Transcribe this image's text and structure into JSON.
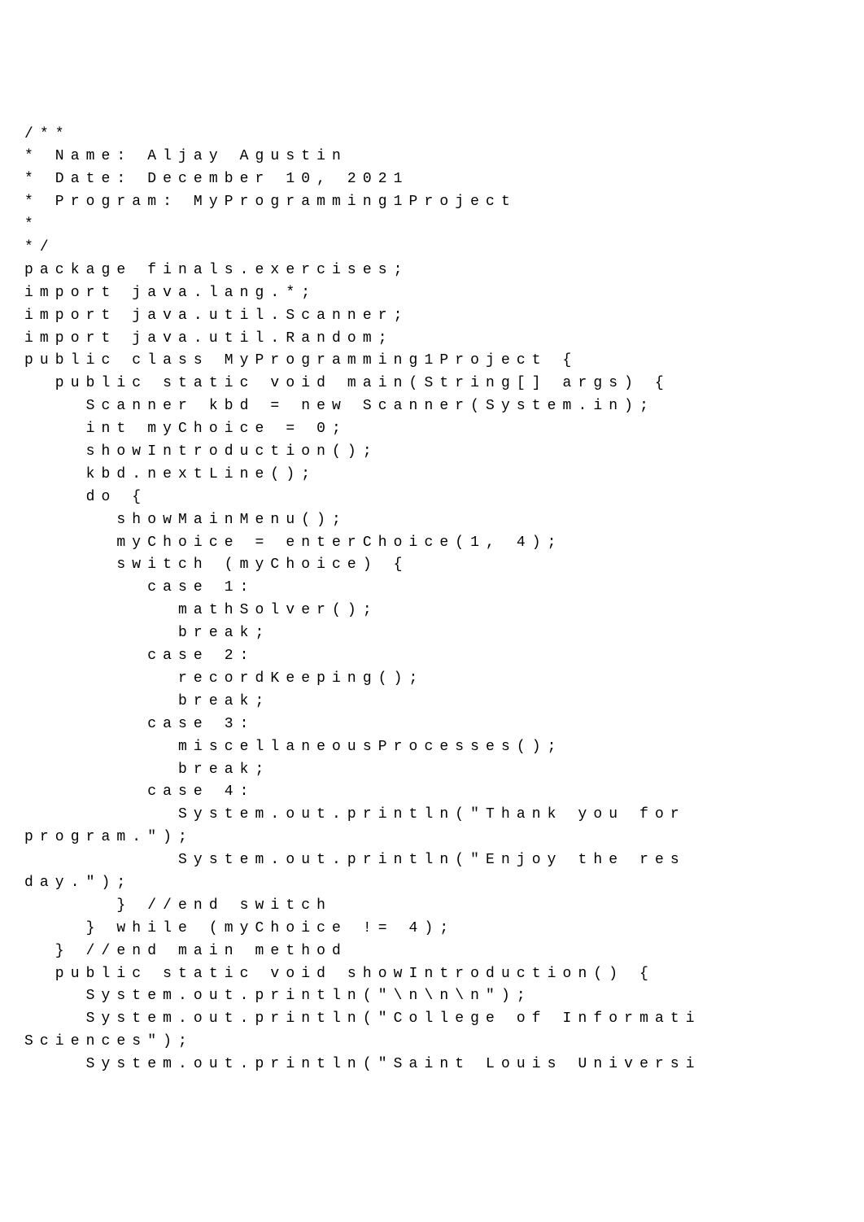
{
  "code": {
    "lines": [
      "/**",
      "* Name: Aljay Agustin",
      "* Date: December 10, 2021",
      "* Program: MyProgramming1Project",
      "*",
      "*/",
      "",
      "package finals.exercises;",
      "",
      "import java.lang.*;",
      "import java.util.Scanner;",
      "import java.util.Random;",
      "",
      "public class MyProgramming1Project {",
      "  public static void main(String[] args) {",
      "    Scanner kbd = new Scanner(System.in);",
      "    int myChoice = 0;",
      "    showIntroduction();",
      "    kbd.nextLine();",
      "    do {",
      "      showMainMenu();",
      "      myChoice = enterChoice(1, 4);",
      "      switch (myChoice) {",
      "        case 1:",
      "          mathSolver();",
      "          break;",
      "        case 2:",
      "          recordKeeping();",
      "          break;",
      "        case 3:",
      "          miscellaneousProcesses();",
      "          break;",
      "        case 4:",
      "          System.out.println(\"Thank you for",
      "program.\");",
      "          System.out.println(\"Enjoy the res",
      "day.\");",
      "      } //end switch",
      "    } while (myChoice != 4);",
      "  } //end main method",
      "  public static void showIntroduction() {",
      "    System.out.println(\"\\n\\n\\n\");",
      "    System.out.println(\"College of Informati",
      "Sciences\");",
      "    System.out.println(\"Saint Louis Universi"
    ]
  }
}
